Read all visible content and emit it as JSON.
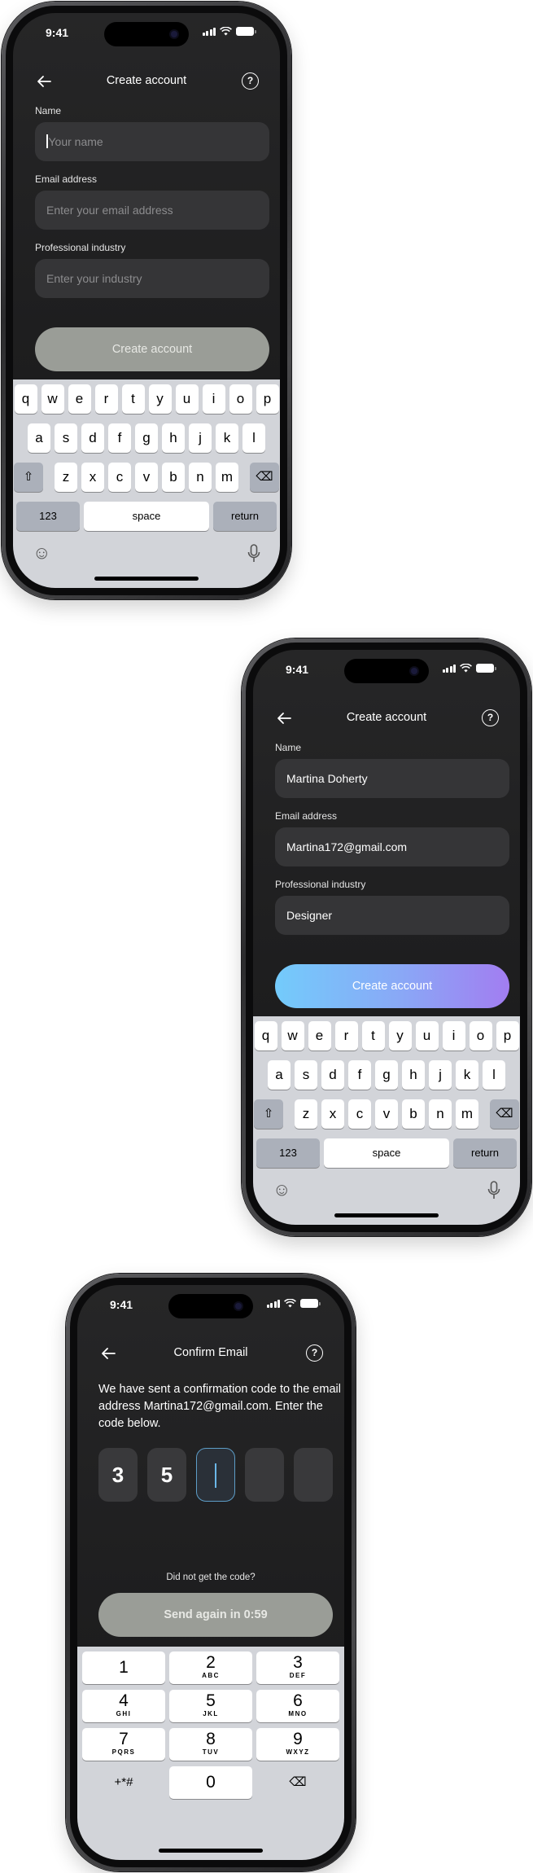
{
  "status_bar": {
    "time": "9:41"
  },
  "screen1": {
    "title": "Create account",
    "fields": [
      {
        "label": "Name",
        "value": "Your name"
      },
      {
        "label": "Email address",
        "value": "Enter your email address"
      },
      {
        "label": "Professional industry",
        "value": "Enter your industry"
      }
    ],
    "button": "Create account"
  },
  "screen2": {
    "title": "Create account",
    "fields": [
      {
        "label": "Name",
        "value": "Martina Doherty"
      },
      {
        "label": "Email address",
        "value": "Martina172@gmail.com"
      },
      {
        "label": "Professional industry",
        "value": "Designer"
      }
    ],
    "button": "Create account"
  },
  "keyboard": {
    "row1": [
      "q",
      "w",
      "e",
      "r",
      "t",
      "y",
      "u",
      "i",
      "o",
      "p"
    ],
    "row2": [
      "a",
      "s",
      "d",
      "f",
      "g",
      "h",
      "j",
      "k",
      "l"
    ],
    "row3": [
      "z",
      "x",
      "c",
      "v",
      "b",
      "n",
      "m"
    ],
    "num_key": "123",
    "space_key": "space",
    "return_key": "return"
  },
  "screen3": {
    "title": "Confirm Email",
    "message": "We have sent a confirmation code to the email address Martina172@gmail.com. Enter the code below.",
    "code_digits": [
      "3",
      "5",
      "",
      "",
      ""
    ],
    "resend_prompt": "Did not get the code?",
    "button": "Send again in 0:59"
  },
  "numpad": {
    "keys": [
      {
        "digit": "1",
        "letters": ""
      },
      {
        "digit": "2",
        "letters": "ABC"
      },
      {
        "digit": "3",
        "letters": "DEF"
      },
      {
        "digit": "4",
        "letters": "GHI"
      },
      {
        "digit": "5",
        "letters": "JKL"
      },
      {
        "digit": "6",
        "letters": "MNO"
      },
      {
        "digit": "7",
        "letters": "PQRS"
      },
      {
        "digit": "8",
        "letters": "TUV"
      },
      {
        "digit": "9",
        "letters": "WXYZ"
      }
    ],
    "symbols": "+*#",
    "zero": "0"
  },
  "colors": {
    "screen_bg": "#1e1e1f",
    "field_bg": "#353537",
    "disabled_button": "#9a9d97",
    "gradient_start": "#73cbfb",
    "gradient_end": "#a27df1",
    "keyboard_bg": "#d2d4d9",
    "active_code_border": "#5d9dc7"
  },
  "icons": {
    "back": "arrow-left-icon",
    "help": "question-circle-icon",
    "shift": "shift-icon",
    "delete": "backspace-icon",
    "emoji": "emoji-icon",
    "mic": "microphone-icon"
  }
}
